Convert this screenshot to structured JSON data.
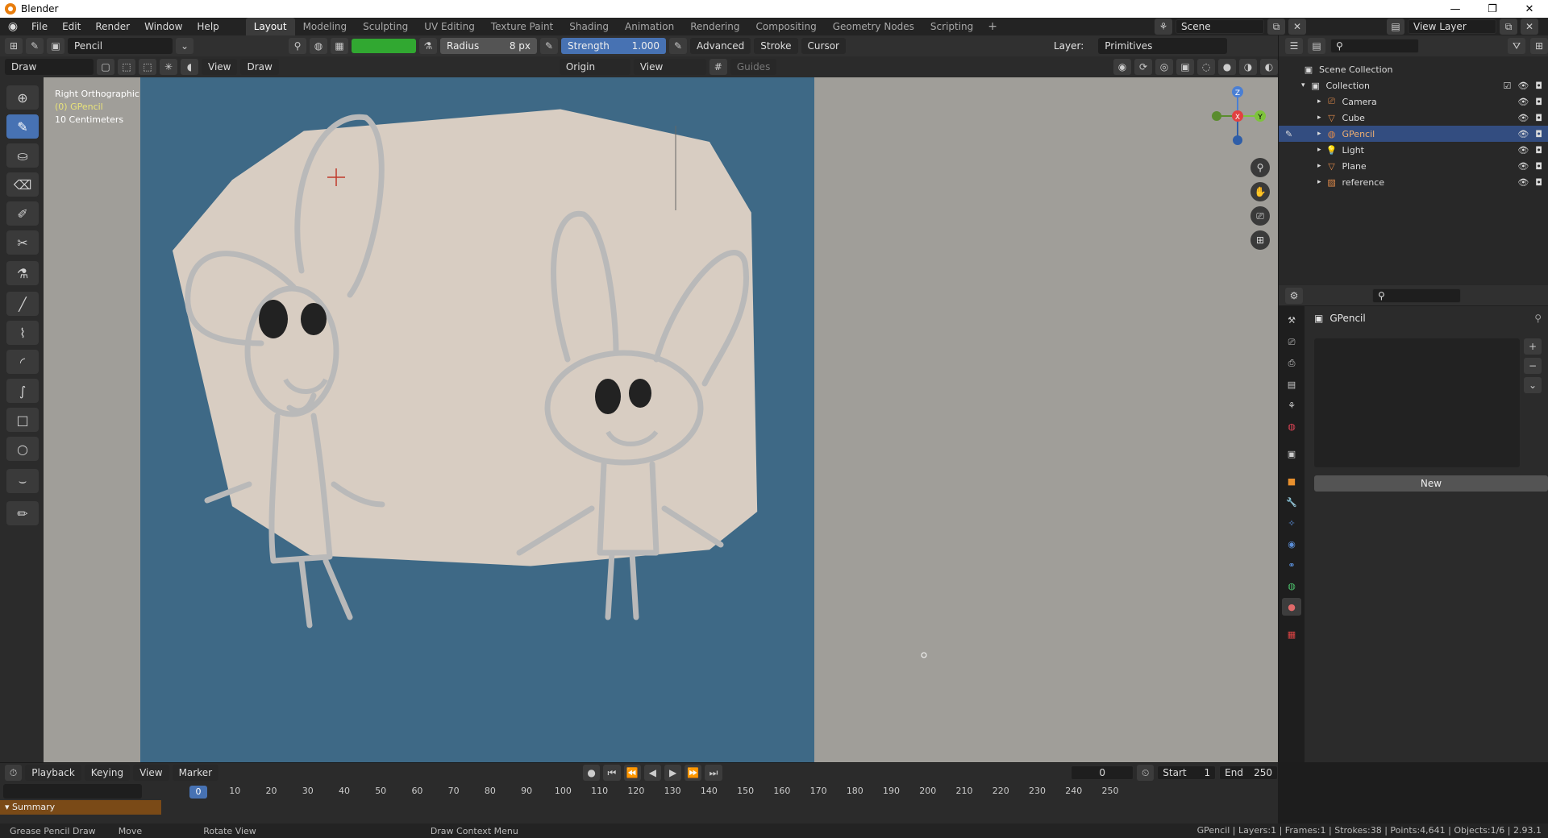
{
  "window": {
    "title": "Blender",
    "min": "—",
    "max": "❐",
    "close": "✕"
  },
  "menu": [
    "File",
    "Edit",
    "Render",
    "Window",
    "Help"
  ],
  "workspaces": [
    "Layout",
    "Modeling",
    "Sculpting",
    "UV Editing",
    "Texture Paint",
    "Shading",
    "Animation",
    "Rendering",
    "Compositing",
    "Geometry Nodes",
    "Scripting"
  ],
  "active_workspace": "Layout",
  "scene": "Scene",
  "view_layer": "View Layer",
  "tool_header": {
    "brush": "Pencil",
    "radius_label": "Radius",
    "radius_value": "8 px",
    "strength_label": "Strength",
    "strength_value": "1.000",
    "advanced": "Advanced",
    "stroke": "Stroke",
    "cursor": "Cursor",
    "layer_label": "Layer:",
    "layer_value": "Primitives",
    "brush_color": "#31a831"
  },
  "viewport_header": {
    "mode": "Draw",
    "view": "View",
    "draw": "Draw",
    "origin": "Origin",
    "view2": "View",
    "guides": "Guides"
  },
  "viewport_overlay": {
    "view_name": "Right Orthographic",
    "object": "(0) GPencil",
    "scale": "10 Centimeters"
  },
  "gizmo": {
    "z": "Z",
    "y": "Y",
    "x": "X"
  },
  "outliner": {
    "root": "Scene Collection",
    "collection": "Collection",
    "items": [
      {
        "name": "Camera",
        "icon": "camera-icon",
        "color": "#e08a4a"
      },
      {
        "name": "Cube",
        "icon": "mesh-icon",
        "color": "#e08a4a"
      },
      {
        "name": "GPencil",
        "icon": "gpencil-icon",
        "color": "#e08a4a",
        "selected": true
      },
      {
        "name": "Light",
        "icon": "light-icon",
        "color": "#e08a4a"
      },
      {
        "name": "Plane",
        "icon": "mesh-icon",
        "color": "#e08a4a"
      },
      {
        "name": "reference",
        "icon": "image-empty-icon",
        "color": "#e08a4a"
      }
    ]
  },
  "properties": {
    "object_name": "GPencil",
    "new_button": "New"
  },
  "timeline": {
    "menus": [
      "Playback",
      "Keying",
      "View",
      "Marker"
    ],
    "current_frame": "0",
    "start_label": "Start",
    "start": "1",
    "end_label": "End",
    "end": "250",
    "ticks": [
      "0",
      "10",
      "20",
      "30",
      "40",
      "50",
      "60",
      "70",
      "80",
      "90",
      "100",
      "110",
      "120",
      "130",
      "140",
      "150",
      "160",
      "170",
      "180",
      "190",
      "200",
      "210",
      "220",
      "230",
      "240",
      "250"
    ],
    "summary": "Summary"
  },
  "statusbar": {
    "left1": "Grease Pencil Draw",
    "left2": "Move",
    "left3": "Rotate View",
    "left4": "Draw Context Menu",
    "stats": "GPencil | Layers:1 | Frames:1 | Strokes:38 | Points:4,641 | Objects:1/6 | 2.93.1"
  }
}
